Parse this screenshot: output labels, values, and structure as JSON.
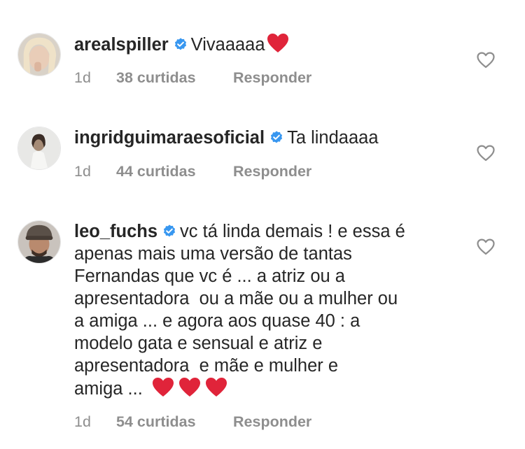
{
  "comments": [
    {
      "username": "arealspiller",
      "text": "Vivaaaaa",
      "time": "1d",
      "likes": "38 curtidas",
      "reply_label": "Responder"
    },
    {
      "username": "ingridguimaraesoficial",
      "text": "Ta lindaaaa",
      "time": "1d",
      "likes": "44 curtidas",
      "reply_label": "Responder"
    },
    {
      "username": "leo_fuchs",
      "text_lines": [
        "vc tá linda demais ! e essa é",
        "apenas mais uma versão de tantas",
        "Fernandas que vc é ... a atriz ou a",
        "apresentadora  ou a mãe ou a mulher ou",
        "a amiga ... e agora aos quase 40 : a",
        "modelo gata e sensual e atriz e",
        "apresentadora  e mãe e mulher e",
        "amiga ..."
      ],
      "time": "1d",
      "likes": "54 curtidas",
      "reply_label": "Responder"
    }
  ],
  "colors": {
    "text": "#262626",
    "secondary": "#8e8e8e",
    "verified": "#3897f0",
    "heart_emoji": "#e0243a",
    "like_icon": "#8e8e8e"
  },
  "icons": {
    "verified": "verified-badge-icon",
    "like": "heart-outline-icon",
    "emoji": "red-heart-emoji"
  }
}
